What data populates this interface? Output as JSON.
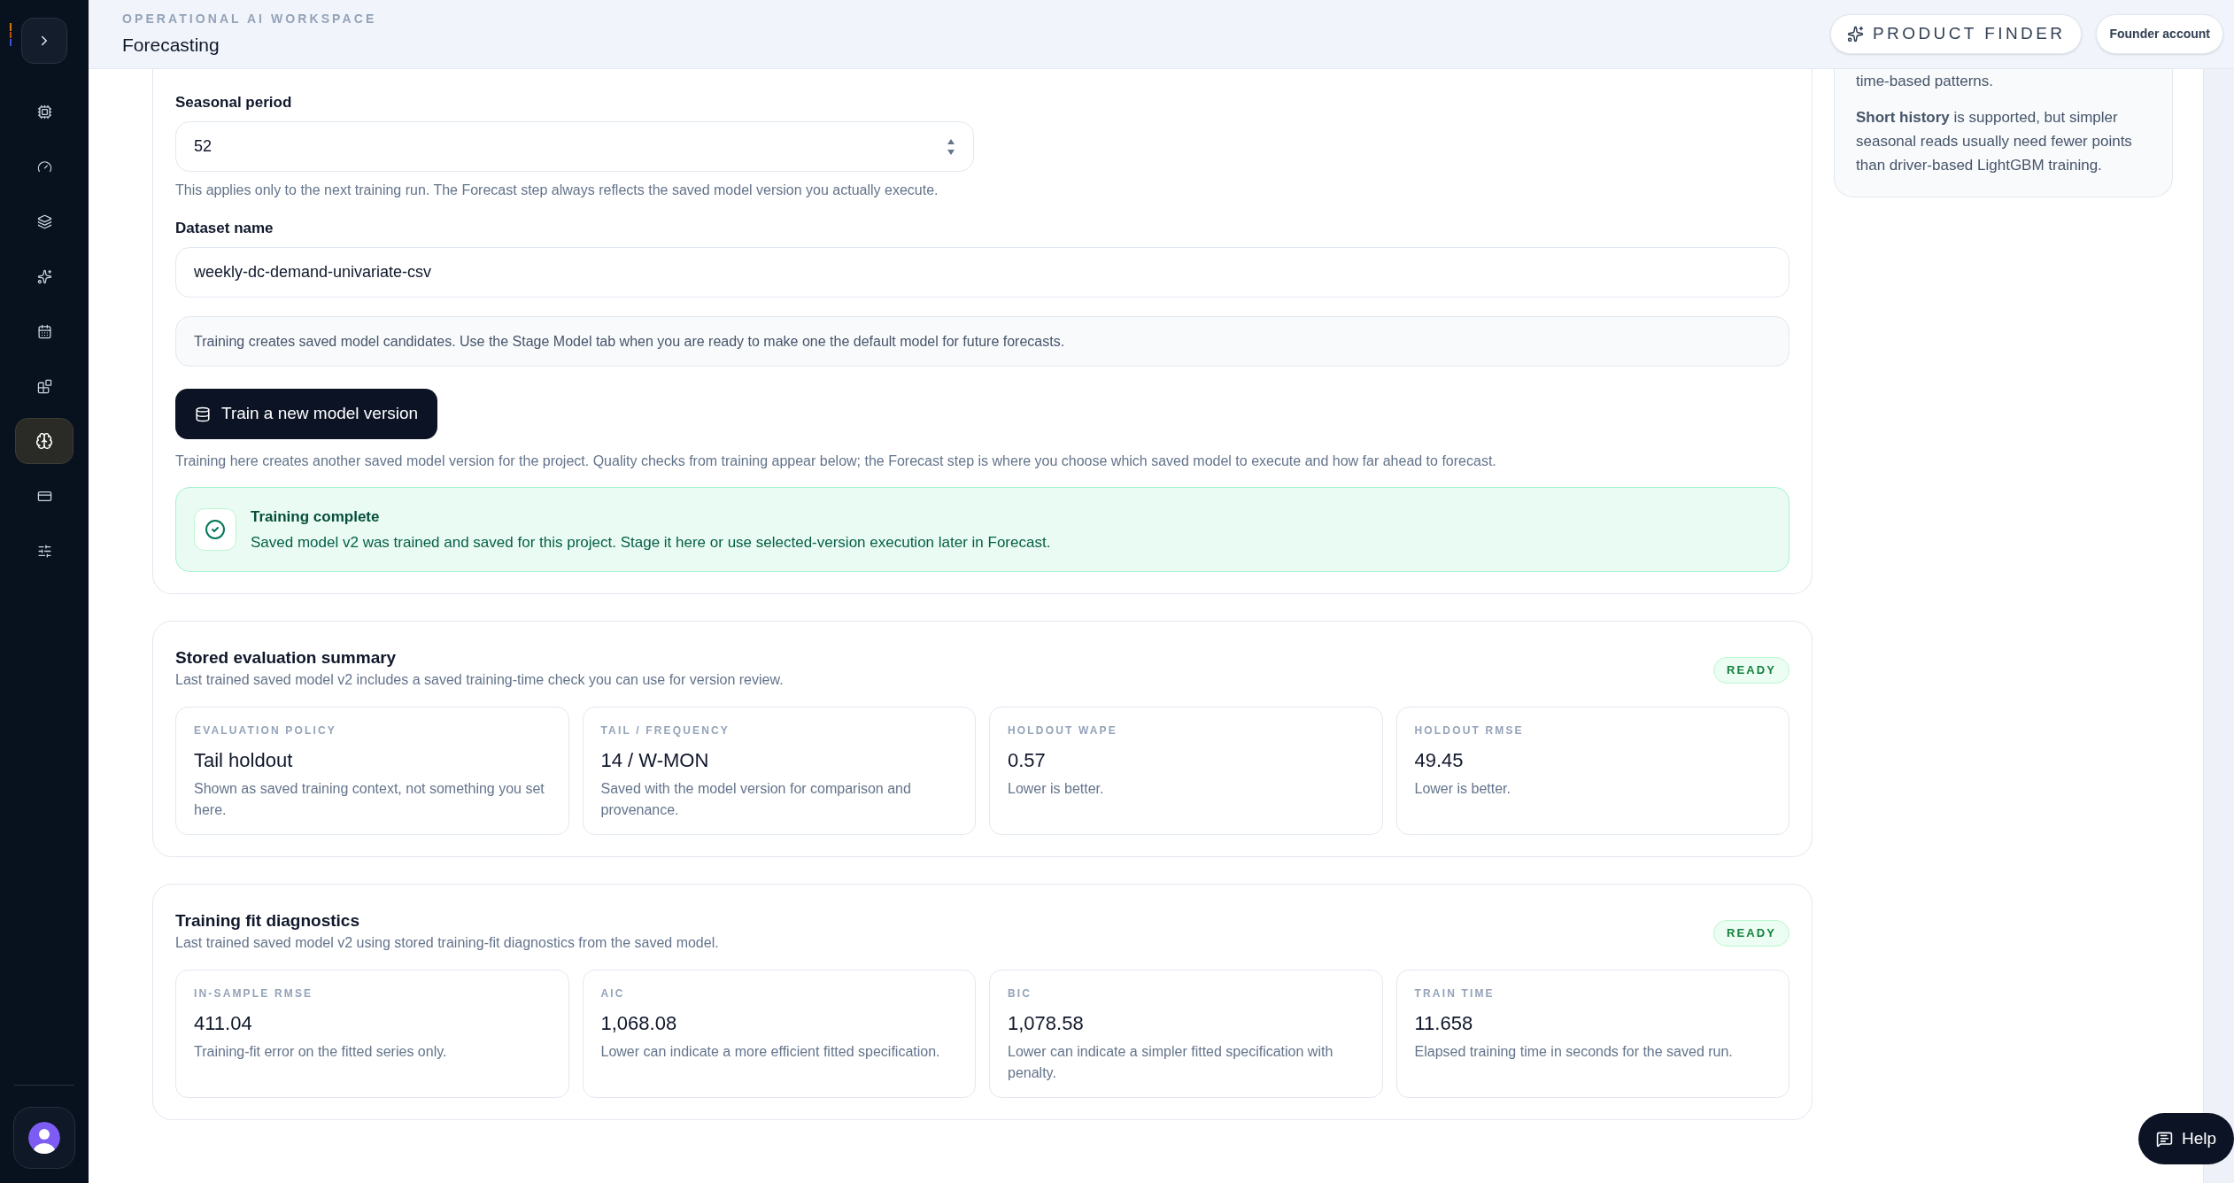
{
  "sidebar": {
    "items": [
      {
        "kind": "chip",
        "selected": false
      },
      {
        "kind": "gauge",
        "selected": false
      },
      {
        "kind": "layers",
        "selected": false
      },
      {
        "kind": "sparkles",
        "selected": false
      },
      {
        "kind": "calendar",
        "selected": false
      },
      {
        "kind": "blocks",
        "selected": false
      },
      {
        "kind": "brain",
        "selected": true
      },
      {
        "kind": "card",
        "selected": false
      },
      {
        "kind": "sliders",
        "selected": false
      }
    ]
  },
  "header": {
    "eyebrow": "OPERATIONAL AI WORKSPACE",
    "title": "Forecasting",
    "product_finder": "PRODUCT FINDER",
    "account": "Founder account"
  },
  "form": {
    "seasonal_period": {
      "label": "Seasonal period",
      "value": "52",
      "hint": "This applies only to the next training run. The Forecast step always reflects the saved model version you actually execute."
    },
    "dataset_name": {
      "label": "Dataset name",
      "value": "weekly-dc-demand-univariate-csv"
    },
    "info": "Training creates saved model candidates. Use the Stage Model tab when you are ready to make one the default model for future forecasts.",
    "train_button": "Train a new model version",
    "train_note": "Training here creates another saved model version for the project. Quality checks from training appear below; the Forecast step is where you choose which saved model to execute and how far ahead to forecast.",
    "alert": {
      "title": "Training complete",
      "message": "Saved model v2 was trained and saved for this project. Stage it here or use selected-version execution later in Forecast."
    }
  },
  "sections": [
    {
      "title": "Stored evaluation summary",
      "subtitle": "Last trained saved model v2 includes a saved training-time check you can use for version review.",
      "badge": "READY",
      "metrics": [
        {
          "label": "EVALUATION POLICY",
          "value": "Tail holdout",
          "note": "Shown as saved training context, not something you set here."
        },
        {
          "label": "TAIL / FREQUENCY",
          "value": "14 / W-MON",
          "note": "Saved with the model version for comparison and provenance."
        },
        {
          "label": "HOLDOUT WAPE",
          "value": "0.57",
          "note": "Lower is better."
        },
        {
          "label": "HOLDOUT RMSE",
          "value": "49.45",
          "note": "Lower is better."
        }
      ]
    },
    {
      "title": "Training fit diagnostics",
      "subtitle": "Last trained saved model v2 using stored training-fit diagnostics from the saved model.",
      "badge": "READY",
      "metrics": [
        {
          "label": "IN-SAMPLE RMSE",
          "value": "411.04",
          "note": "Training-fit error on the fitted series only."
        },
        {
          "label": "AIC",
          "value": "1,068.08",
          "note": "Lower can indicate a more efficient fitted specification."
        },
        {
          "label": "BIC",
          "value": "1,078.58",
          "note": "Lower can indicate a simpler fitted specification with penalty."
        },
        {
          "label": "TRAIN TIME",
          "value": "11.658",
          "note": "Elapsed training time in seconds for the saved run."
        }
      ]
    }
  ],
  "side_panel": {
    "paragraphs": [
      "time-based patterns.",
      "**Short history** is supported, but simpler seasonal reads usually need fewer points than driver-based LightGBM training."
    ]
  },
  "help_button": "Help"
}
